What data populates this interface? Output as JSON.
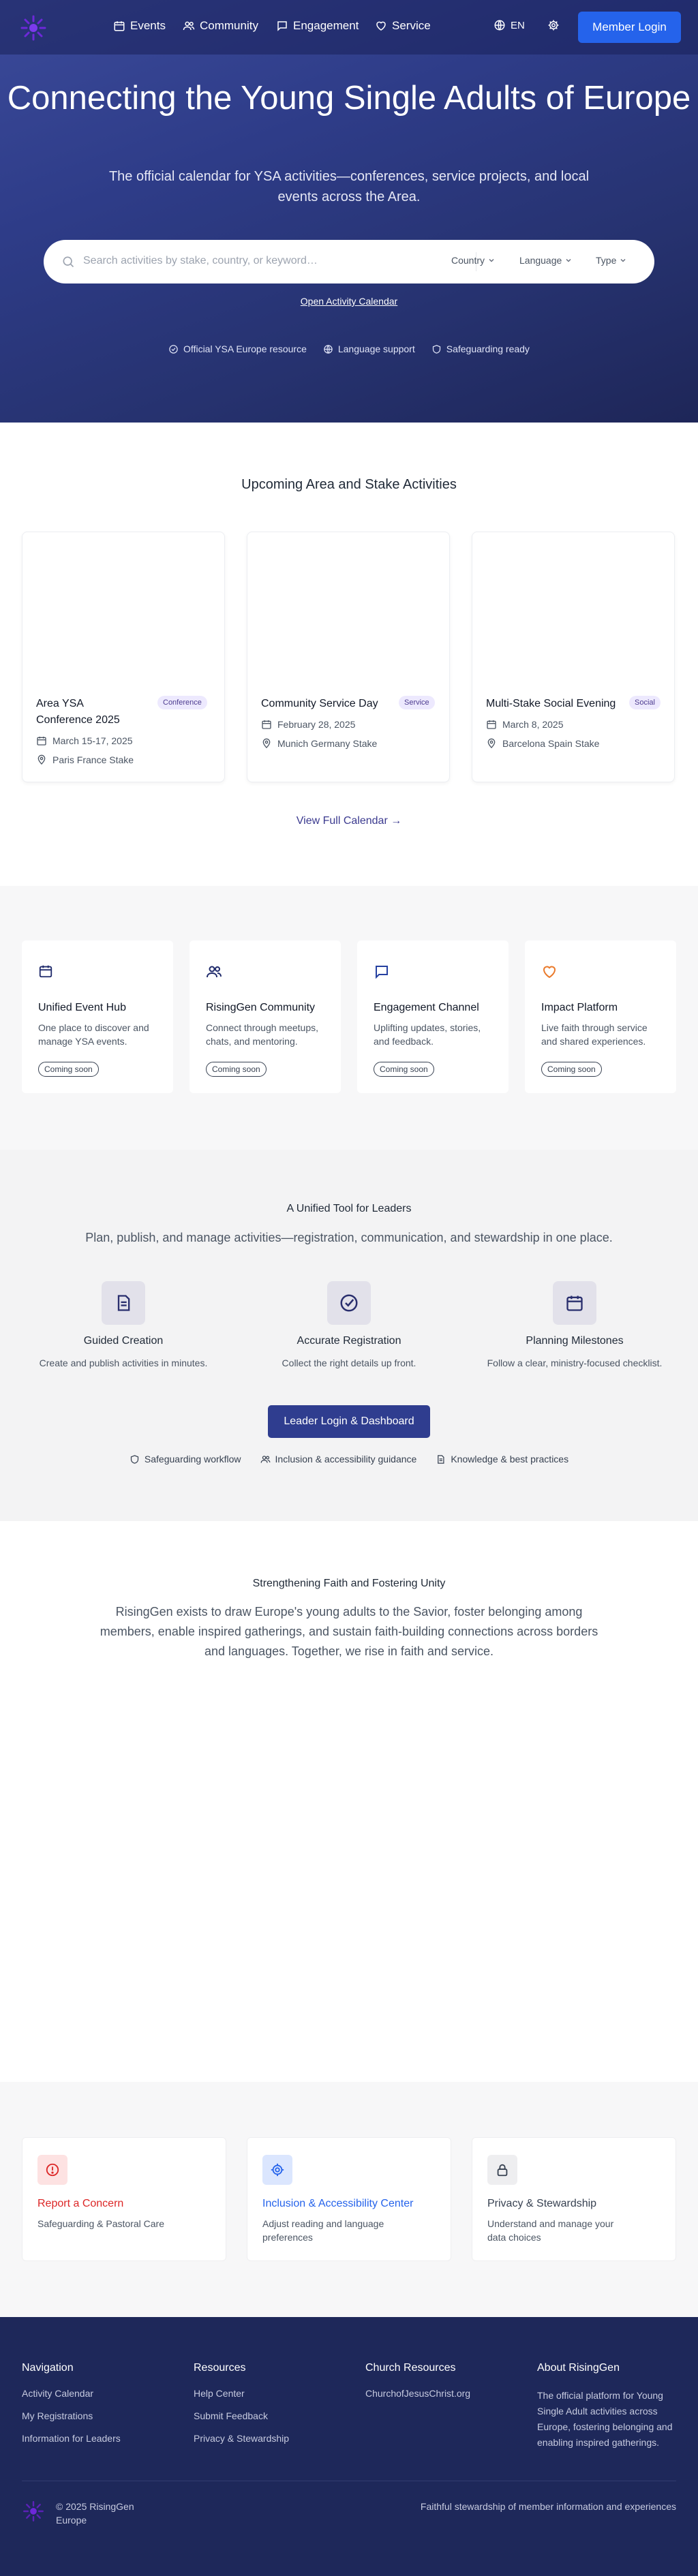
{
  "nav": {
    "items": [
      {
        "label": "Events",
        "icon": "calendar-icon"
      },
      {
        "label": "Community",
        "icon": "users-icon"
      },
      {
        "label": "Engagement",
        "icon": "chat-icon"
      },
      {
        "label": "Service",
        "icon": "heart-icon"
      }
    ],
    "language": "EN",
    "member_login": "Member Login"
  },
  "hero": {
    "title": "Connecting the Young Single Adults of Europe",
    "subtitle": "The official calendar for YSA activities—conferences, service projects, and local events across the Area.",
    "search_placeholder": "Search activities by stake, country, or keyword…",
    "filters": [
      "Country",
      "Language",
      "Type"
    ],
    "open_calendar": "Open Activity Calendar",
    "badges": [
      "Official YSA Europe resource",
      "Language support",
      "Safeguarding ready"
    ]
  },
  "upcoming": {
    "title": "Upcoming Area and Stake Activities",
    "events": [
      {
        "title": "Area YSA Conference 2025",
        "tag": "Conference",
        "date": "March 15-17, 2025",
        "location": "Paris France Stake"
      },
      {
        "title": "Community Service Day",
        "tag": "Service",
        "date": "February 28, 2025",
        "location": "Munich Germany Stake"
      },
      {
        "title": "Multi-Stake Social Evening",
        "tag": "Social",
        "date": "March 8, 2025",
        "location": "Barcelona Spain Stake"
      }
    ],
    "view_full": "View Full Calendar →"
  },
  "features": [
    {
      "title": "Unified Event Hub",
      "desc": "One place to discover and manage YSA events.",
      "badge": "Coming soon",
      "icon": "calendar-icon",
      "color": "#1f2a6b"
    },
    {
      "title": "RisingGen Community",
      "desc": "Connect through meetups, chats, and mentoring.",
      "badge": "Coming soon",
      "icon": "users-icon",
      "color": "#1f2a6b"
    },
    {
      "title": "Engagement Channel",
      "desc": "Uplifting updates, stories, and feedback.",
      "badge": "Coming soon",
      "icon": "chat-icon",
      "color": "#2540a0"
    },
    {
      "title": "Impact Platform",
      "desc": "Live faith through service and shared experiences.",
      "badge": "Coming soon",
      "icon": "heart-icon",
      "color": "#ea7a2b"
    }
  ],
  "leaders": {
    "title": "A Unified Tool for Leaders",
    "subtitle": "Plan, publish, and manage activities—registration, communication, and stewardship in one place.",
    "items": [
      {
        "title": "Guided Creation",
        "desc": "Create and publish activities in minutes.",
        "icon": "document-icon"
      },
      {
        "title": "Accurate Registration",
        "desc": "Collect the right details up front.",
        "icon": "check-circle-icon"
      },
      {
        "title": "Planning Milestones",
        "desc": "Follow a clear, ministry-focused checklist.",
        "icon": "calendar-icon"
      }
    ],
    "button": "Leader Login & Dashboard",
    "badges": [
      "Safeguarding workflow",
      "Inclusion & accessibility guidance",
      "Knowledge & best practices"
    ]
  },
  "faith": {
    "title": "Strengthening Faith and Fostering Unity",
    "body": "RisingGen exists to draw Europe's young adults to the Savior, foster belonging among members, enable inspired gatherings, and sustain faith-building connections across borders and languages. Together, we rise in faith and service."
  },
  "help": [
    {
      "title": "Report a Concern",
      "desc": "Safeguarding & Pastoral Care",
      "icon": "alert-icon",
      "color": "#dc2626"
    },
    {
      "title": "Inclusion & Accessibility Center",
      "desc": "Adjust reading and language preferences",
      "icon": "gear-icon",
      "color": "#2563eb"
    },
    {
      "title": "Privacy & Stewardship",
      "desc": "Understand and manage your data choices",
      "icon": "lock-icon",
      "color": "#374151"
    }
  ],
  "footer": {
    "cols": [
      {
        "heading": "Navigation",
        "links": [
          "Activity Calendar",
          "My Registrations",
          "Information for Leaders"
        ]
      },
      {
        "heading": "Resources",
        "links": [
          "Help Center",
          "Submit Feedback",
          "Privacy & Stewardship"
        ]
      },
      {
        "heading": "Church Resources",
        "links": [
          "ChurchofJesusChrist.org"
        ]
      }
    ],
    "about_heading": "About RisingGen",
    "about_text": "The official platform for Young Single Adult activities across Europe, fostering belonging and enabling inspired gatherings.",
    "copyright": "© 2025 RisingGen Europe",
    "tagline": "Faithful stewardship of member information and experiences"
  },
  "colors": {
    "primary": "#2563eb",
    "navy": "#1e285a",
    "leader_button": "#2f3d8f"
  }
}
